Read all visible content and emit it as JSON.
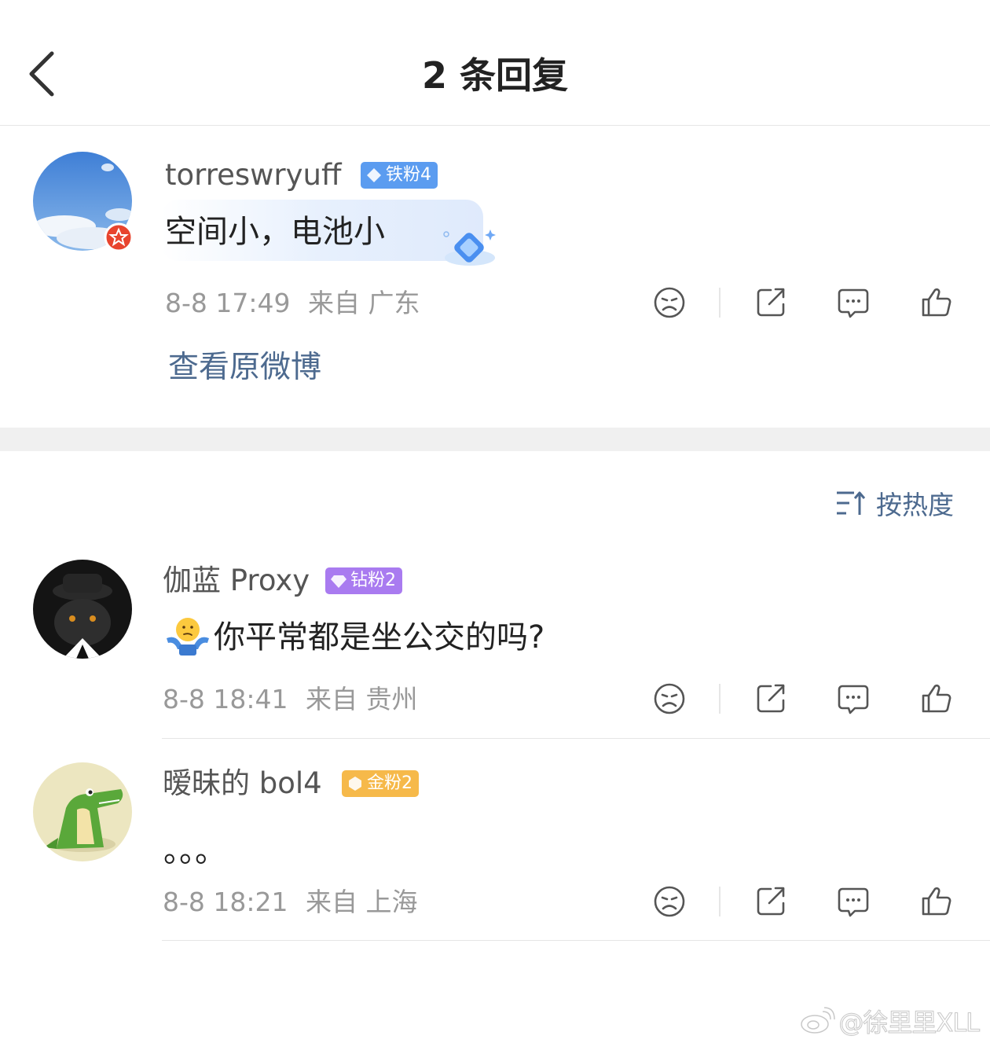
{
  "header": {
    "title": "2 条回复"
  },
  "original": {
    "username": "torreswryuff",
    "badge": "铁粉4",
    "badge_color": "#5b9cf0",
    "content": "空间小，电池小",
    "time": "8-8 17:49",
    "source": "来自 广东",
    "view_original": "查看原微博"
  },
  "sort": {
    "label": "按热度"
  },
  "replies": [
    {
      "username": "伽蓝 Proxy",
      "badge": "钻粉2",
      "badge_color": "#a97bf0",
      "content": "你平常都是坐公交的吗?",
      "time": "8-8 18:41",
      "source": "来自 贵州"
    },
    {
      "username": "暧昧的 bol4",
      "badge": "金粉2",
      "badge_color": "#f6b94a",
      "content": "。。。",
      "time": "8-8 18:21",
      "source": "来自 上海"
    }
  ],
  "watermark": "@徐里里XLL",
  "icons": [
    "back-icon",
    "dislike-icon",
    "share-icon",
    "comment-icon",
    "like-icon",
    "sort-icon",
    "weibo-icon"
  ]
}
